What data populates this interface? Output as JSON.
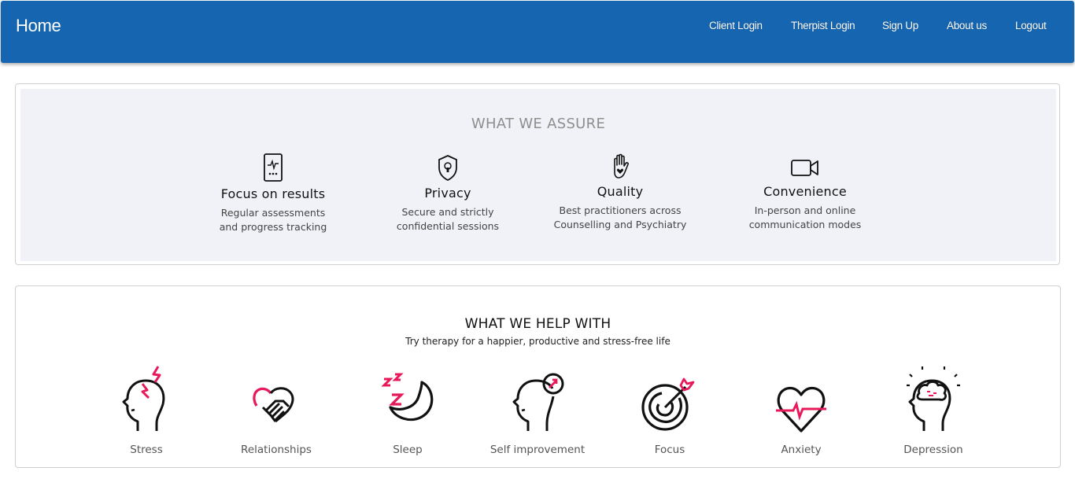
{
  "navbar": {
    "brand": "Home",
    "links": [
      "Client Login",
      "Therpist Login",
      "Sign Up",
      "About us",
      "Logout"
    ],
    "bg_color": "#1565b0"
  },
  "assure": {
    "title": "WHAT WE ASSURE",
    "features": [
      {
        "icon": "phone-chart-icon",
        "title": "Focus on results",
        "desc": "Regular assessments\nand progress tracking"
      },
      {
        "icon": "shield-lock-icon",
        "title": "Privacy",
        "desc": "Secure and strictly\nconfidential sessions"
      },
      {
        "icon": "hand-heart-icon",
        "title": "Quality",
        "desc": "Best practitioners across\nCounselling and Psychiatry"
      },
      {
        "icon": "video-camera-icon",
        "title": "Convenience",
        "desc": "In-person and online\ncommunication modes"
      }
    ]
  },
  "help": {
    "title": "WHAT WE HELP WITH",
    "subtitle": "Try therapy for a happier, productive and stress-free life",
    "accent_color": "#e8195a",
    "topics": [
      {
        "icon": "stressed-head-icon",
        "label": "Stress"
      },
      {
        "icon": "handshake-heart-icon",
        "label": "Relationships"
      },
      {
        "icon": "moon-zzz-icon",
        "label": "Sleep"
      },
      {
        "icon": "head-growth-icon",
        "label": "Self improvement"
      },
      {
        "icon": "target-arrow-icon",
        "label": "Focus"
      },
      {
        "icon": "heart-pulse-icon",
        "label": "Anxiety"
      },
      {
        "icon": "head-brain-icon",
        "label": "Depression"
      }
    ]
  }
}
